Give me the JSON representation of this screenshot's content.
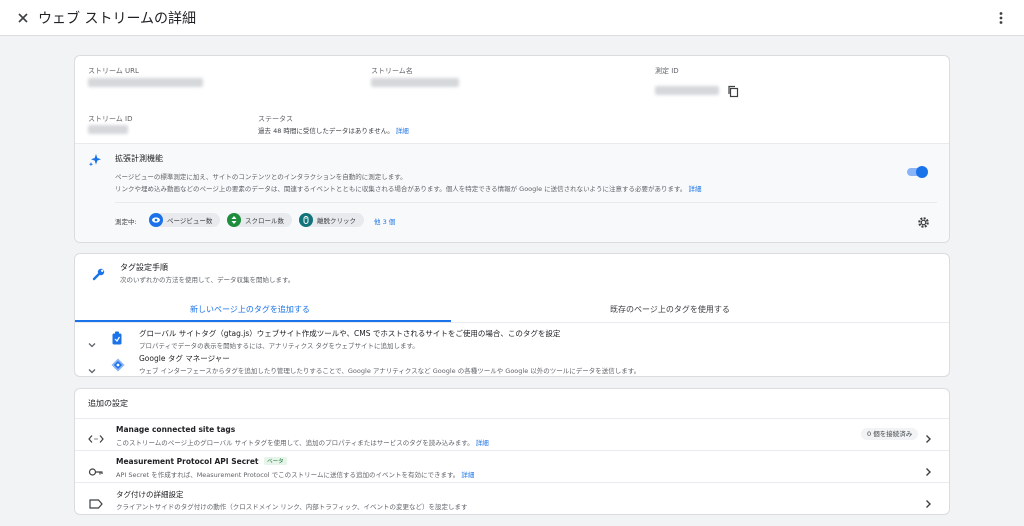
{
  "header": {
    "title": "ウェブ ストリームの詳細"
  },
  "stream": {
    "url_label": "ストリーム URL",
    "name_label": "ストリーム名",
    "measurement_id_label": "測定 ID",
    "stream_id_label": "ストリーム ID",
    "status_label": "ステータス",
    "status_text": "過去 48 時間に受信したデータはありません。",
    "status_link": "詳細"
  },
  "enhanced": {
    "title": "拡張計測機能",
    "desc1": "ページビューの標準測定に加え、サイトのコンテンツとのインタラクションを自動的に測定します。",
    "desc2": "リンクや埋め込み動画などのページ上の要素のデータは、関連するイベントとともに収集される場合があります。個人を特定できる情報が Google に送信されないように注意する必要があります。",
    "desc2_link": "詳細",
    "measuring_label": "測定中:",
    "chips": [
      "ページビュー数",
      "スクロール数",
      "離脱クリック"
    ],
    "more": "他 3 個",
    "toggle_on": true,
    "accent": "#1a73e8"
  },
  "tagging": {
    "title": "タグ設定手順",
    "subtitle": "次のいずれかの方法を使用して、データ収集を開始します。",
    "tabs": [
      "新しいページ上のタグを追加する",
      "既存のページ上のタグを使用する"
    ],
    "options": [
      {
        "title": "グローバル サイトタグ（gtag.js）ウェブサイト作成ツールや、CMS でホストされるサイトをご使用の場合、このタグを設定",
        "desc": "プロパティでデータの表示を開始するには、アナリティクス タグをウェブサイトに追加します。"
      },
      {
        "title": "Google タグ マネージャー",
        "desc": "ウェブ インターフェースからタグを追加したり管理したりすることで、Google アナリティクスなど Google の各種ツールや Google 以外のツールにデータを送信します。"
      }
    ]
  },
  "additional": {
    "title": "追加の設定",
    "rows": [
      {
        "title": "Manage connected site tags",
        "desc": "このストリームのページ上のグローバル サイトタグを使用して、追加のプロパティまたはサービスのタグを読み込みます。",
        "link": "詳細",
        "badge": "0 個を接続済み"
      },
      {
        "title": "Measurement Protocol API Secret",
        "tag": "ベータ",
        "desc": "API Secret を作成すれば、Measurement Protocol でこのストリームに送信する追加のイベントを有効にできます。",
        "link": "詳細"
      },
      {
        "title": "タグ付けの詳細設定",
        "desc": "クライアントサイドのタグ付けの動作（クロスドメイン リンク、内部トラフィック、イベントの変更など）を設定します"
      }
    ]
  }
}
